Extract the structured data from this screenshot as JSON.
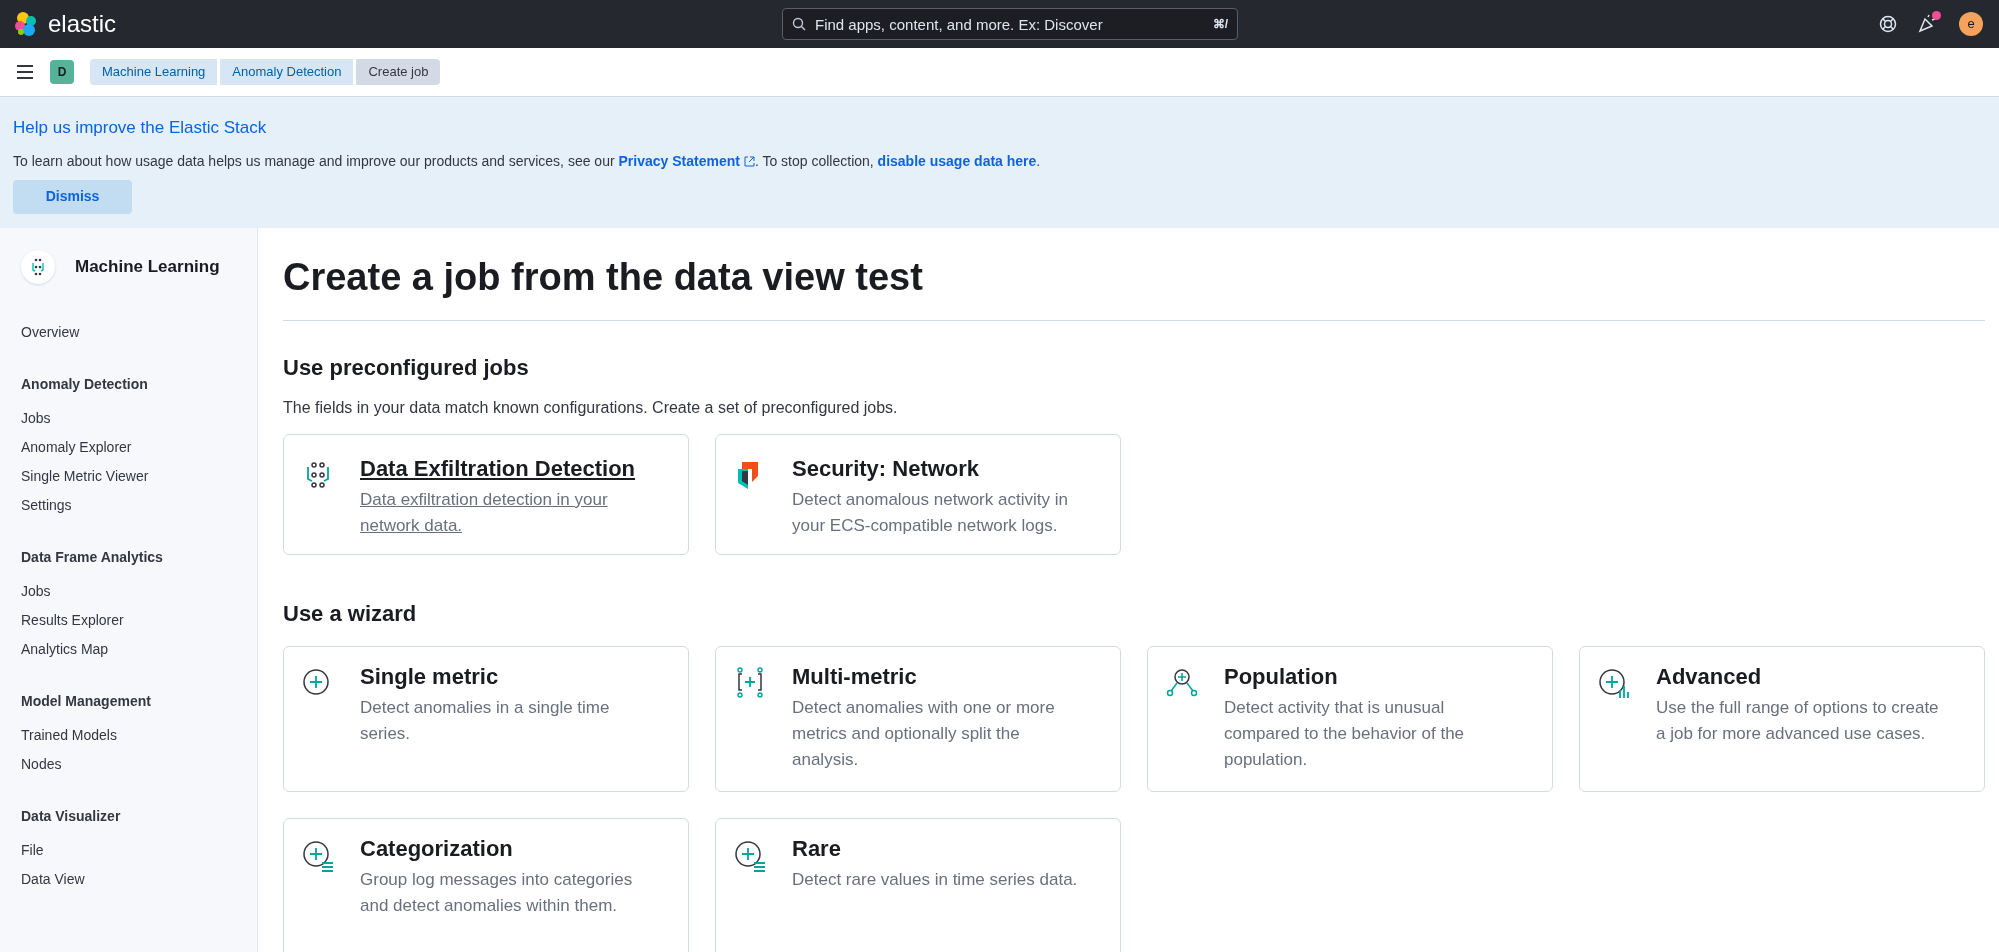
{
  "header": {
    "brand": "elastic",
    "search": {
      "placeholder": "Find apps, content, and more. Ex: Discover",
      "shortcut": "⌘/"
    },
    "avatar": "e",
    "news_unread": true
  },
  "nav": {
    "space": "D",
    "breadcrumbs": [
      {
        "label": "Machine Learning",
        "current": false
      },
      {
        "label": "Anomaly Detection",
        "current": false
      },
      {
        "label": "Create job",
        "current": true
      }
    ]
  },
  "banner": {
    "title": "Help us improve the Elastic Stack",
    "text_before": "To learn about how usage data helps us manage and improve our products and services, see our",
    "link": "Privacy Statement",
    "text_middle": ". To stop collection,",
    "link2": "disable usage data here",
    "text_after": ".",
    "button": "Dismiss"
  },
  "sidebar": {
    "title": "Machine Learning",
    "groups": [
      {
        "items": [
          "Overview"
        ]
      },
      {
        "heading": "Anomaly Detection",
        "items": [
          "Jobs",
          "Anomaly Explorer",
          "Single Metric Viewer",
          "Settings"
        ]
      },
      {
        "heading": "Data Frame Analytics",
        "items": [
          "Jobs",
          "Results Explorer",
          "Analytics Map"
        ]
      },
      {
        "heading": "Model Management",
        "items": [
          "Trained Models",
          "Nodes"
        ]
      },
      {
        "heading": "Data Visualizer",
        "items": [
          "File",
          "Data View"
        ]
      }
    ]
  },
  "page_title": "Create a job from the data view test",
  "preconfigured": {
    "heading": "Use preconfigured jobs",
    "description": "The fields in your data match known configurations. Create a set of preconfigured jobs.",
    "cards": [
      {
        "title": "Data Exfiltration Detection",
        "description": "Data exfiltration detection in your network data.",
        "hovered": true
      },
      {
        "title": "Security: Network",
        "description": "Detect anomalous network activity in your ECS-compatible network logs.",
        "hovered": false
      }
    ]
  },
  "wizard": {
    "heading": "Use a wizard",
    "cards": [
      {
        "title": "Single metric",
        "description": "Detect anomalies in a single time series."
      },
      {
        "title": "Multi-metric",
        "description": "Detect anomalies with one or more metrics and optionally split the analysis."
      },
      {
        "title": "Population",
        "description": "Detect activity that is unusual compared to the behavior of the population."
      },
      {
        "title": "Advanced",
        "description": "Use the full range of options to create a job for more advanced use cases."
      },
      {
        "title": "Categorization",
        "description": "Group log messages into categories and detect anomalies within them."
      },
      {
        "title": "Rare",
        "description": "Detect rare values in time series data."
      }
    ]
  }
}
